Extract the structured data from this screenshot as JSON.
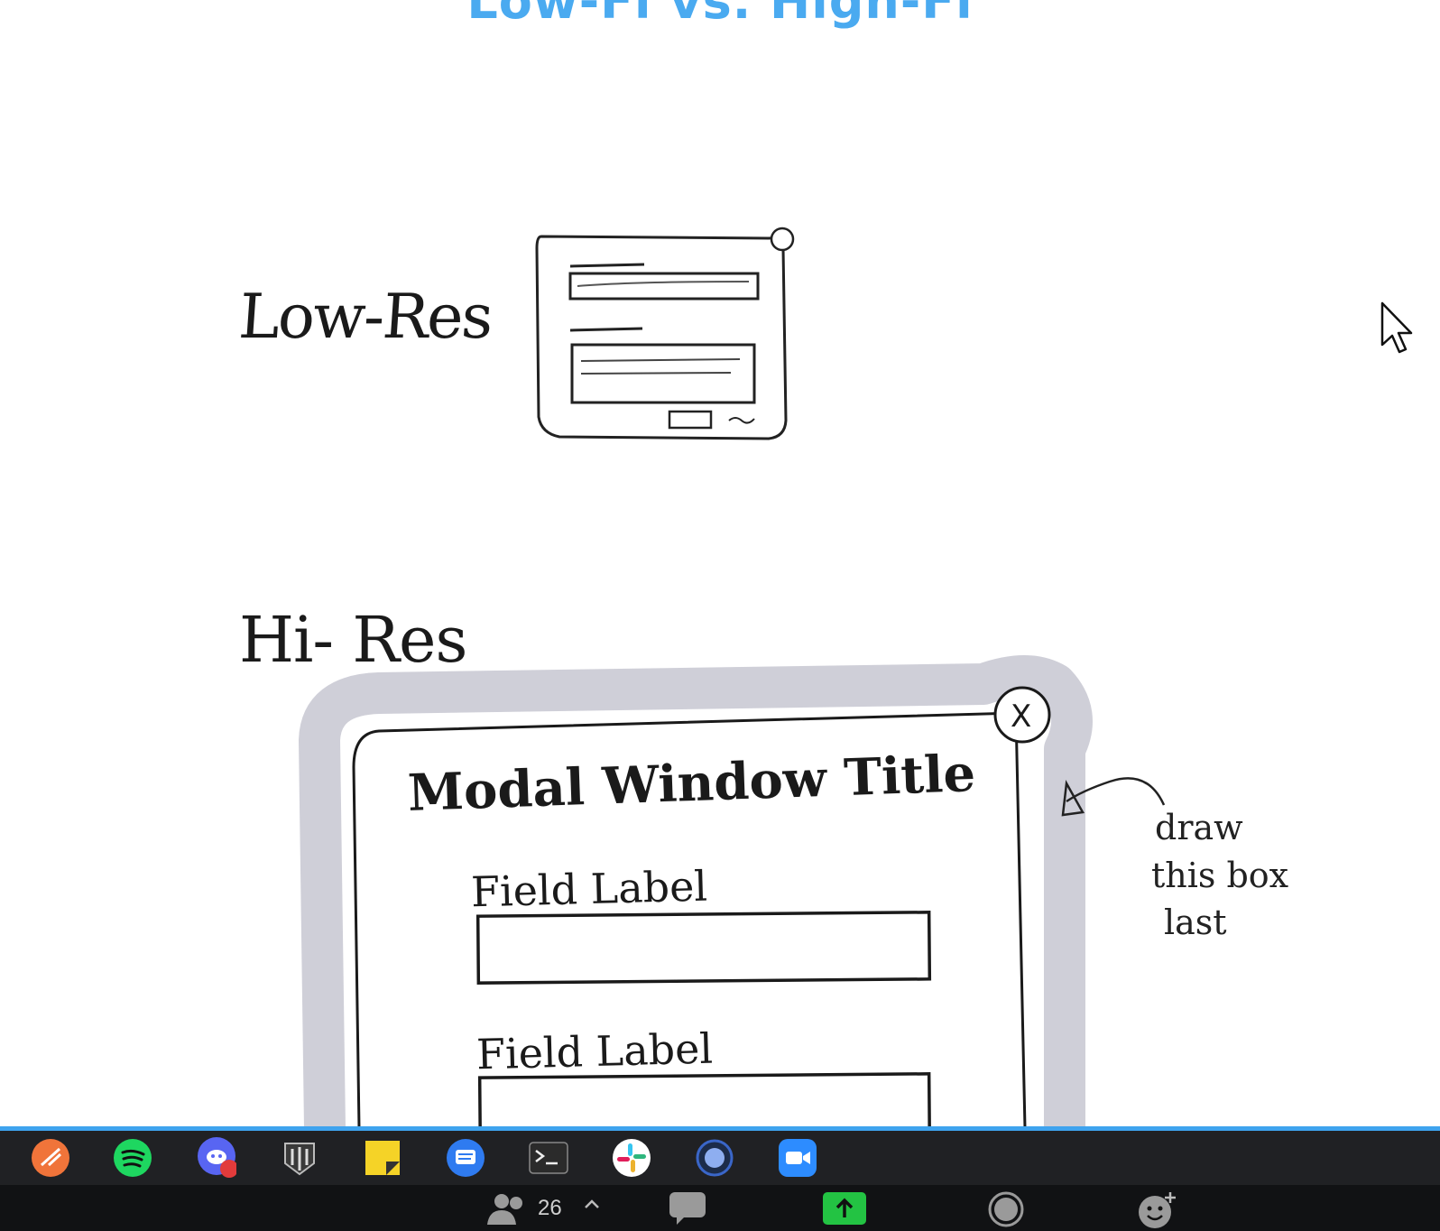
{
  "slide": {
    "title": "Low-Fi vs. High-Fi",
    "low_res_label": "Low-Res",
    "hi_res_label": "Hi- Res",
    "modal": {
      "title": "Modal Window Title",
      "field_label_1": "Field Label",
      "field_label_2": "Field Label",
      "close_glyph": "X"
    },
    "annotation": [
      "draw",
      "this box",
      "last"
    ]
  },
  "dock": {
    "apps": [
      {
        "name": "swift-playgrounds",
        "color": "#f0743a"
      },
      {
        "name": "spotify",
        "color": "#1ed760"
      },
      {
        "name": "discord",
        "color": "#5865f2",
        "badge": "1"
      },
      {
        "name": "world-of-tanks",
        "color": "#3a3a3a"
      },
      {
        "name": "stickies",
        "color": "#f5d327"
      },
      {
        "name": "messages",
        "color": "#2f7bf0"
      },
      {
        "name": "terminal",
        "color": "#2b2b2b"
      },
      {
        "name": "slack",
        "color": "#ffffff"
      },
      {
        "name": "app-circle",
        "color": "#3a66c8"
      },
      {
        "name": "zoom",
        "color": "#2d8cff"
      }
    ]
  },
  "meeting": {
    "participants": "26",
    "share_color": "#23c343"
  }
}
